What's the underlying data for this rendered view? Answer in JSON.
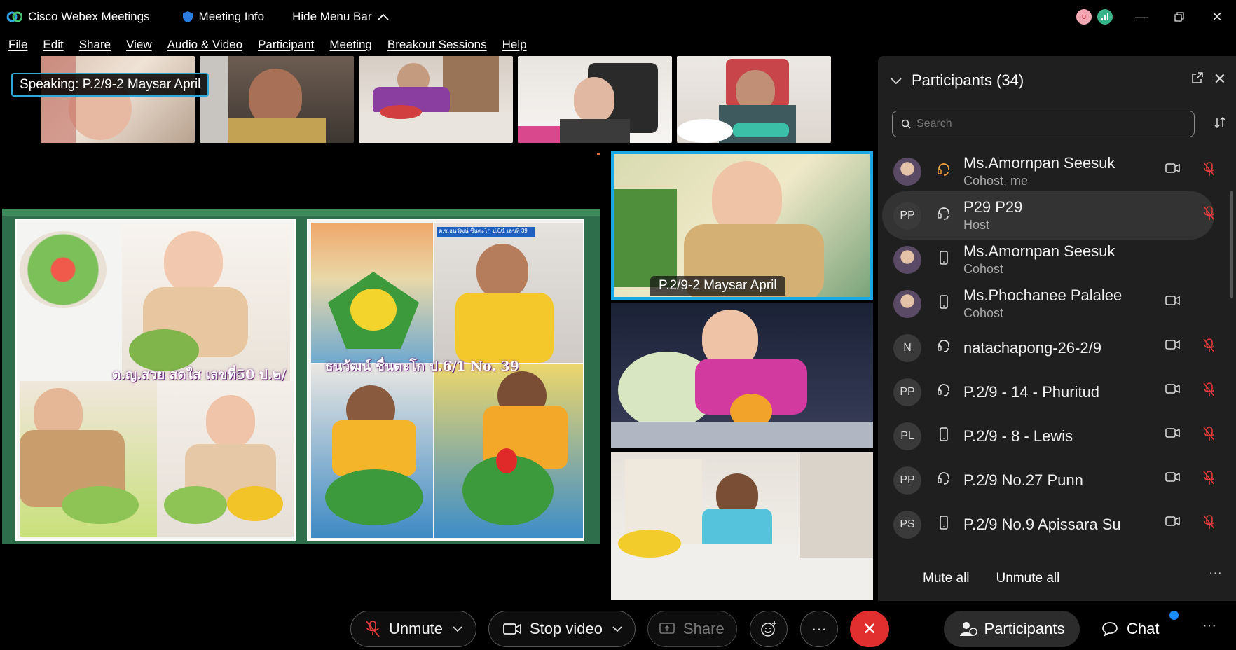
{
  "app": {
    "title": "Cisco Webex Meetings",
    "meeting_info": "Meeting Info",
    "hide_menu": "Hide Menu Bar",
    "status_badge_letter": "o"
  },
  "menu": [
    "File",
    "Edit",
    "Share",
    "View",
    "Audio & Video",
    "Participant",
    "Meeting",
    "Breakout Sessions",
    "Help"
  ],
  "speaking_label": "Speaking: P.2/9-2 Maysar April",
  "shared_content": {
    "caption_left": "ด.ญ.สวย สดใส เลขที่50 ป.๒/",
    "caption_right": "ธนวัฒน์ ชื่นตะโก ป.6/1 No. 39",
    "tag_right": "ด.ช.ธนวัฒน์ ชื่นตะโก ป.6/1 เลขที่ 39"
  },
  "active_tile_name": "P.2/9-2 Maysar April",
  "participants_panel": {
    "title": "Participants (34)",
    "search_placeholder": "Search",
    "mute_all": "Mute all",
    "unmute_all": "Unmute all",
    "rows": [
      {
        "initials": "",
        "name": "Ms.Amornpan Seesuk",
        "role": "Cohost, me",
        "status": "headset-orange",
        "cam": true,
        "mic_muted": true,
        "selected": false
      },
      {
        "initials": "PP",
        "name": "P29 P29",
        "role": "Host",
        "status": "headset",
        "cam": false,
        "mic_muted": true,
        "selected": true
      },
      {
        "initials": "",
        "name": "Ms.Amornpan Seesuk",
        "role": "Cohost",
        "status": "phone",
        "cam": false,
        "mic_muted": false,
        "selected": false
      },
      {
        "initials": "",
        "name": "Ms.Phochanee Palalee",
        "role": "Cohost",
        "status": "phone",
        "cam": true,
        "mic_muted": false,
        "selected": false
      },
      {
        "initials": "N",
        "name": "natachapong-26-2/9",
        "role": "",
        "status": "headset",
        "cam": true,
        "mic_muted": true,
        "selected": false
      },
      {
        "initials": "PP",
        "name": "P.2/9 - 14 - Phuritud",
        "role": "",
        "status": "headset",
        "cam": true,
        "mic_muted": true,
        "selected": false
      },
      {
        "initials": "PL",
        "name": "P.2/9 - 8 - Lewis",
        "role": "",
        "status": "phone",
        "cam": true,
        "mic_muted": true,
        "selected": false
      },
      {
        "initials": "PP",
        "name": "P.2/9 No.27 Punn",
        "role": "",
        "status": "headset",
        "cam": true,
        "mic_muted": true,
        "selected": false
      },
      {
        "initials": "PS",
        "name": "P.2/9 No.9 Apissara Su",
        "role": "",
        "status": "phone",
        "cam": true,
        "mic_muted": true,
        "selected": false
      }
    ]
  },
  "controls": {
    "unmute": "Unmute",
    "stop_video": "Stop video",
    "share": "Share",
    "more": "···",
    "participants": "Participants",
    "chat": "Chat"
  }
}
